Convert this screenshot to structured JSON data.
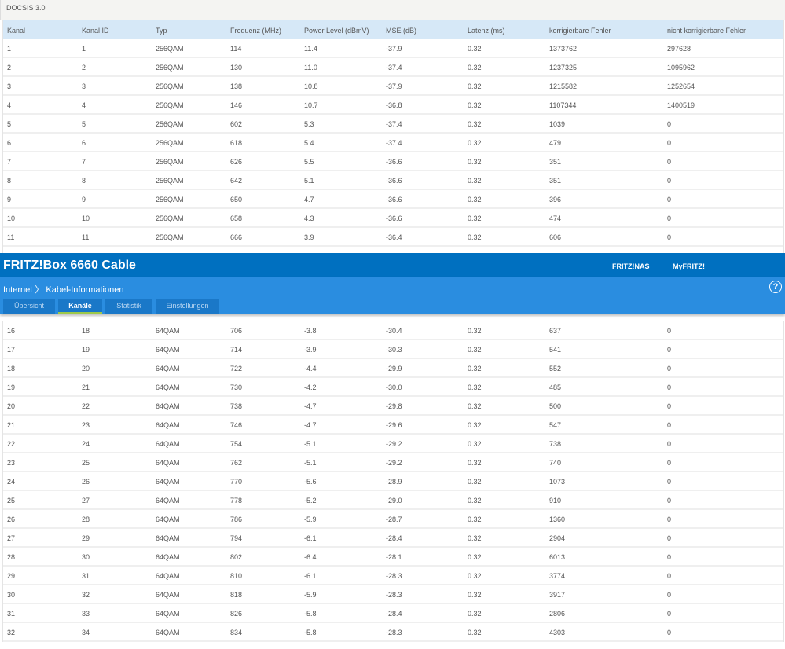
{
  "caption": "DOCSIS 3.0",
  "columns": [
    "Kanal",
    "Kanal ID",
    "Typ",
    "Frequenz (MHz)",
    "Power Level (dBmV)",
    "MSE (dB)",
    "Latenz (ms)",
    "korrigierbare Fehler",
    "nicht korrigierbare Fehler"
  ],
  "rows_top": [
    [
      "1",
      "1",
      "256QAM",
      "114",
      "11.4",
      "-37.9",
      "0.32",
      "1373762",
      "297628"
    ],
    [
      "2",
      "2",
      "256QAM",
      "130",
      "11.0",
      "-37.4",
      "0.32",
      "1237325",
      "1095962"
    ],
    [
      "3",
      "3",
      "256QAM",
      "138",
      "10.8",
      "-37.9",
      "0.32",
      "1215582",
      "1252654"
    ],
    [
      "4",
      "4",
      "256QAM",
      "146",
      "10.7",
      "-36.8",
      "0.32",
      "1107344",
      "1400519"
    ],
    [
      "5",
      "5",
      "256QAM",
      "602",
      "5.3",
      "-37.4",
      "0.32",
      "1039",
      "0"
    ],
    [
      "6",
      "6",
      "256QAM",
      "618",
      "5.4",
      "-37.4",
      "0.32",
      "479",
      "0"
    ],
    [
      "7",
      "7",
      "256QAM",
      "626",
      "5.5",
      "-36.6",
      "0.32",
      "351",
      "0"
    ],
    [
      "8",
      "8",
      "256QAM",
      "642",
      "5.1",
      "-36.6",
      "0.32",
      "351",
      "0"
    ],
    [
      "9",
      "9",
      "256QAM",
      "650",
      "4.7",
      "-36.6",
      "0.32",
      "396",
      "0"
    ],
    [
      "10",
      "10",
      "256QAM",
      "658",
      "4.3",
      "-36.6",
      "0.32",
      "474",
      "0"
    ],
    [
      "11",
      "11",
      "256QAM",
      "666",
      "3.9",
      "-36.4",
      "0.32",
      "606",
      "0"
    ]
  ],
  "rows_bottom": [
    [
      "16",
      "18",
      "64QAM",
      "706",
      "-3.8",
      "-30.4",
      "0.32",
      "637",
      "0"
    ],
    [
      "17",
      "19",
      "64QAM",
      "714",
      "-3.9",
      "-30.3",
      "0.32",
      "541",
      "0"
    ],
    [
      "18",
      "20",
      "64QAM",
      "722",
      "-4.4",
      "-29.9",
      "0.32",
      "552",
      "0"
    ],
    [
      "19",
      "21",
      "64QAM",
      "730",
      "-4.2",
      "-30.0",
      "0.32",
      "485",
      "0"
    ],
    [
      "20",
      "22",
      "64QAM",
      "738",
      "-4.7",
      "-29.8",
      "0.32",
      "500",
      "0"
    ],
    [
      "21",
      "23",
      "64QAM",
      "746",
      "-4.7",
      "-29.6",
      "0.32",
      "547",
      "0"
    ],
    [
      "22",
      "24",
      "64QAM",
      "754",
      "-5.1",
      "-29.2",
      "0.32",
      "738",
      "0"
    ],
    [
      "23",
      "25",
      "64QAM",
      "762",
      "-5.1",
      "-29.2",
      "0.32",
      "740",
      "0"
    ],
    [
      "24",
      "26",
      "64QAM",
      "770",
      "-5.6",
      "-28.9",
      "0.32",
      "1073",
      "0"
    ],
    [
      "25",
      "27",
      "64QAM",
      "778",
      "-5.2",
      "-29.0",
      "0.32",
      "910",
      "0"
    ],
    [
      "26",
      "28",
      "64QAM",
      "786",
      "-5.9",
      "-28.7",
      "0.32",
      "1360",
      "0"
    ],
    [
      "27",
      "29",
      "64QAM",
      "794",
      "-6.1",
      "-28.4",
      "0.32",
      "2904",
      "0"
    ],
    [
      "28",
      "30",
      "64QAM",
      "802",
      "-6.4",
      "-28.1",
      "0.32",
      "6013",
      "0"
    ],
    [
      "29",
      "31",
      "64QAM",
      "810",
      "-6.1",
      "-28.3",
      "0.32",
      "3774",
      "0"
    ],
    [
      "30",
      "32",
      "64QAM",
      "818",
      "-5.9",
      "-28.3",
      "0.32",
      "3917",
      "0"
    ],
    [
      "31",
      "33",
      "64QAM",
      "826",
      "-5.8",
      "-28.4",
      "0.32",
      "2806",
      "0"
    ],
    [
      "32",
      "34",
      "64QAM",
      "834",
      "-5.8",
      "-28.3",
      "0.32",
      "4303",
      "0"
    ]
  ],
  "header": {
    "brand": "FRITZ!Box 6660 Cable",
    "links": [
      "FRITZ!NAS",
      "MyFRITZ!"
    ],
    "breadcrumb": "Internet 〉 Kabel-Informationen",
    "help_icon": "help-circle-icon",
    "help_glyph": "?",
    "tabs": [
      {
        "label": "Übersicht",
        "active": false
      },
      {
        "label": "Kanäle",
        "active": true
      },
      {
        "label": "Statistik",
        "active": false
      },
      {
        "label": "Einstellungen",
        "active": false
      }
    ]
  },
  "colors": {
    "header_dark": "#0070c0",
    "header_light": "#2a8de0",
    "table_head": "#d6e8f7",
    "tab_active_underline": "#9ec94a"
  }
}
